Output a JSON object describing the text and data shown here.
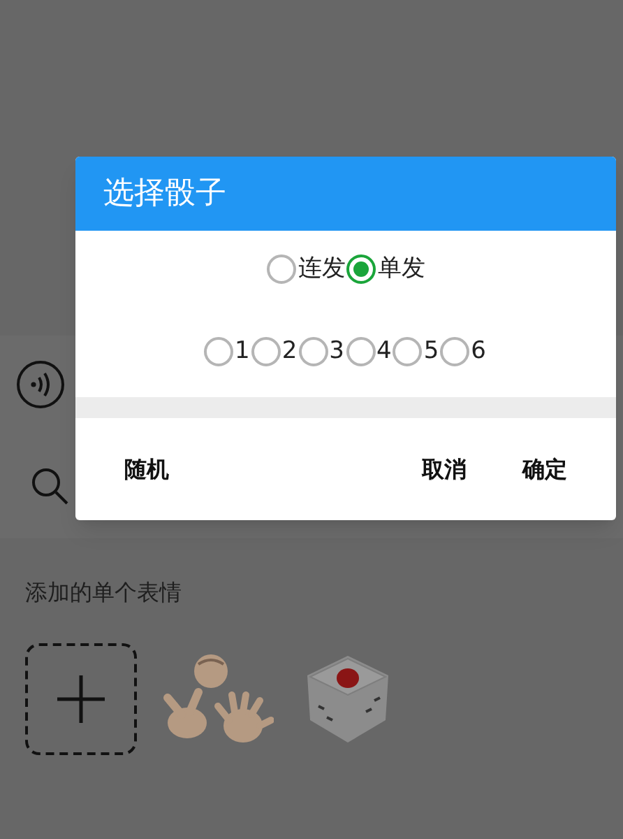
{
  "section_title": "添加的单个表情",
  "stickers": [
    {
      "kind": "add"
    },
    {
      "kind": "hands"
    },
    {
      "kind": "dice"
    }
  ],
  "dialog": {
    "title": "选择骰子",
    "mode_options": [
      {
        "label": "连发",
        "selected": false
      },
      {
        "label": "单发",
        "selected": true
      }
    ],
    "number_options": [
      {
        "label": "1",
        "selected": false
      },
      {
        "label": "2",
        "selected": false
      },
      {
        "label": "3",
        "selected": false
      },
      {
        "label": "4",
        "selected": false
      },
      {
        "label": "5",
        "selected": false
      },
      {
        "label": "6",
        "selected": false
      }
    ],
    "buttons": [
      {
        "label": "随机"
      },
      {
        "label": "取消"
      },
      {
        "label": "确定"
      }
    ]
  }
}
